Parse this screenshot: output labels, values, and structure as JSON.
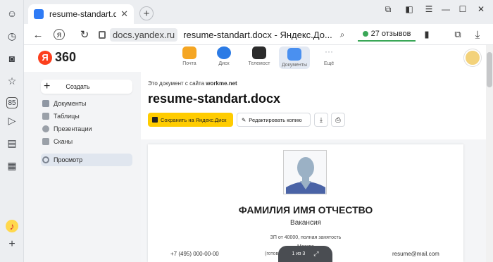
{
  "browser": {
    "tab_title": "resume-standart.docx",
    "new_tab": "+",
    "domain": "docs.yandex.ru",
    "page_title": "resume-standart.docx - Яндекс.До...",
    "reviews": "27 отзывов"
  },
  "header": {
    "logo_letter": "Я",
    "logo_text": "360",
    "services": [
      {
        "label": "Почта",
        "color": "#f5a623"
      },
      {
        "label": "Диск",
        "color": "#2c7be5"
      },
      {
        "label": "Телемост",
        "color": "#2b2b2b"
      },
      {
        "label": "Документы",
        "color": "#4a90f0"
      },
      {
        "label": "Ещё",
        "color": "#c9ccd1"
      }
    ]
  },
  "sidebar": {
    "create_label": "Создать",
    "items": [
      {
        "label": "Документы"
      },
      {
        "label": "Таблицы"
      },
      {
        "label": "Презентации"
      },
      {
        "label": "Сканы"
      }
    ],
    "preview_label": "Просмотр"
  },
  "main": {
    "source_prefix": "Это документ с сайта",
    "source_site": "workme.net",
    "title": "resume-standart.docx",
    "save_button": "Сохранить на Яндекс.Диск",
    "edit_button": "Редактировать копию"
  },
  "document": {
    "name": "ФАМИЛИЯ ИМЯ ОТЧЕСТВО",
    "vacancy": "Вакансия",
    "salary": "ЗП от 40000, полная занятость",
    "city": "Москва",
    "phone": "+7 (495) 000-00-00",
    "ready": "(готов к командировкам)",
    "email": "resume@mail.com",
    "pager": "1 из 3"
  },
  "colors": {
    "accent": "#ffcc00",
    "brand": "#fc3f1d"
  }
}
